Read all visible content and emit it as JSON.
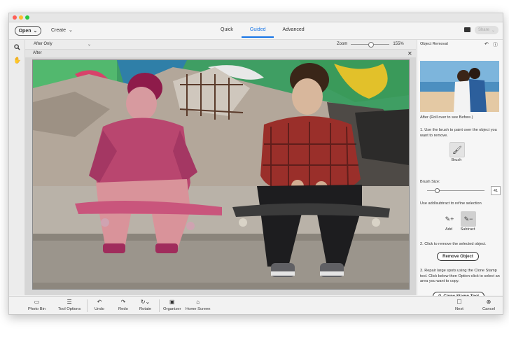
{
  "header": {
    "open_label": "Open",
    "create_label": "Create",
    "tabs": [
      {
        "label": "Quick",
        "active": false
      },
      {
        "label": "Guided",
        "active": true
      },
      {
        "label": "Advanced",
        "active": false
      }
    ],
    "share_label": "Share"
  },
  "toolbar": {
    "view_select": "After Only",
    "zoom_label": "Zoom",
    "zoom_value": "155%",
    "zoom_level": 0.5
  },
  "canvas": {
    "header_label": "After",
    "close_glyph": "✕"
  },
  "panel": {
    "title": "Object Removal",
    "caption": "After (Roll over to see Before.)",
    "step1": "1. Use the brush to paint over the object you want to remove.",
    "brush_label": "Brush",
    "brush_size_label": "Brush Size:",
    "brush_size_value": "41",
    "refine_text": "Use add/subtract to refine selection",
    "add_label": "Add",
    "subtract_label": "Subtract",
    "step2": "2. Click to remove the selected object.",
    "remove_button": "Remove Object",
    "step3": "3. Repair large spots using the Clone Stamp tool. Click below then Option-click to select an area you want to copy.",
    "clone_button": "Clone Stamp Tool"
  },
  "bottom": {
    "photo_bin": "Photo Bin",
    "tool_options": "Tool Options",
    "undo": "Undo",
    "redo": "Redo",
    "rotate": "Rotate",
    "organizer": "Organizer",
    "home_screen": "Home Screen",
    "next": "Next",
    "cancel": "Cancel"
  },
  "colors": {
    "accent": "#1473e6",
    "selection_overlay": "#c8386c"
  }
}
